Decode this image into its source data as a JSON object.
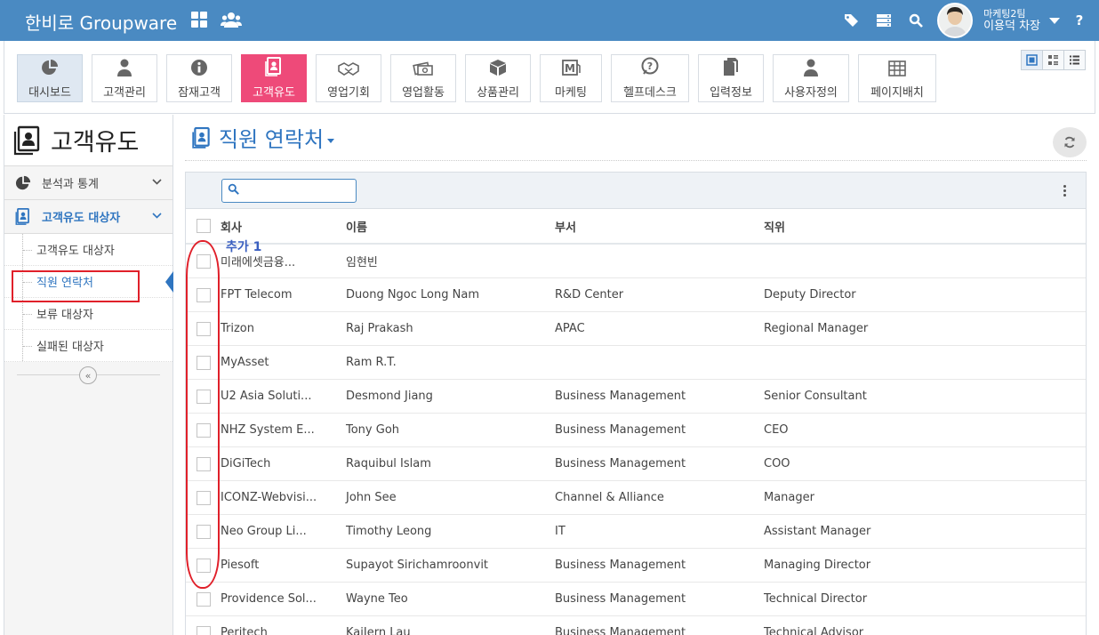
{
  "header": {
    "brand": "한비로 Groupware",
    "user_team": "마케팅2팀",
    "user_name": "이용덕 차장",
    "help": "?"
  },
  "modules": [
    {
      "label": "대시보드",
      "icon": "pie-chart-icon"
    },
    {
      "label": "고객관리",
      "icon": "person-icon"
    },
    {
      "label": "잠재고객",
      "icon": "info-icon"
    },
    {
      "label": "고객유도",
      "icon": "contact-card-icon"
    },
    {
      "label": "영업기회",
      "icon": "handshake-icon"
    },
    {
      "label": "영업활동",
      "icon": "money-icon"
    },
    {
      "label": "상품관리",
      "icon": "box-icon"
    },
    {
      "label": "마케팅",
      "icon": "mail-m-icon"
    },
    {
      "label": "헬프데스크",
      "icon": "question-bubble-icon"
    },
    {
      "label": "입력정보",
      "icon": "documents-icon"
    },
    {
      "label": "사용자정의",
      "icon": "user-icon"
    },
    {
      "label": "페이지배치",
      "icon": "table-icon"
    }
  ],
  "sidebar": {
    "title": "고객유도",
    "sections": [
      {
        "label": "분석과 통계"
      },
      {
        "label": "고객유도 대상자"
      }
    ],
    "items": [
      {
        "label": "고객유도 대상자"
      },
      {
        "label": "직원 연락처"
      },
      {
        "label": "보류 대상자"
      },
      {
        "label": "실패된 대상자"
      }
    ]
  },
  "main": {
    "title": "직원 연락처",
    "search_placeholder": "",
    "columns": [
      "회사",
      "이름",
      "부서",
      "직위"
    ],
    "annotation": "추가 1",
    "rows": [
      {
        "company": "미래에셋금융...",
        "name": "임현빈",
        "dept": "",
        "title": ""
      },
      {
        "company": "FPT Telecom",
        "name": "Duong Ngoc Long Nam",
        "dept": "R&D Center",
        "title": "Deputy Director"
      },
      {
        "company": "Trizon",
        "name": "Raj Prakash",
        "dept": "APAC",
        "title": "Regional Manager"
      },
      {
        "company": "MyAsset",
        "name": "Ram R.T.",
        "dept": "",
        "title": ""
      },
      {
        "company": "U2 Asia Soluti...",
        "name": "Desmond Jiang",
        "dept": "Business Management",
        "title": "Senior Consultant"
      },
      {
        "company": "NHZ System E...",
        "name": "Tony Goh",
        "dept": "Business Management",
        "title": "CEO"
      },
      {
        "company": "DiGiTech",
        "name": "Raquibul Islam",
        "dept": "Business Management",
        "title": "COO"
      },
      {
        "company": "ICONZ-Webvisi...",
        "name": "John See",
        "dept": "Channel & Alliance",
        "title": "Manager"
      },
      {
        "company": "Neo Group Li...",
        "name": "Timothy Leong",
        "dept": "IT",
        "title": "Assistant Manager"
      },
      {
        "company": "Piesoft",
        "name": "Supayot Sirichamroonvit",
        "dept": "Business Management",
        "title": "Managing Director"
      },
      {
        "company": "Providence Sol...",
        "name": "Wayne Teo",
        "dept": "Business Management",
        "title": "Technical Director"
      },
      {
        "company": "Peritech",
        "name": "KaiJern Lau",
        "dept": "Business Management",
        "title": "Technical Advisor"
      }
    ]
  },
  "colors": {
    "header_bg": "#4a8ac2",
    "active_module": "#ee4a79",
    "accent_blue": "#2f75c0",
    "annotation_red": "#e0202a"
  }
}
